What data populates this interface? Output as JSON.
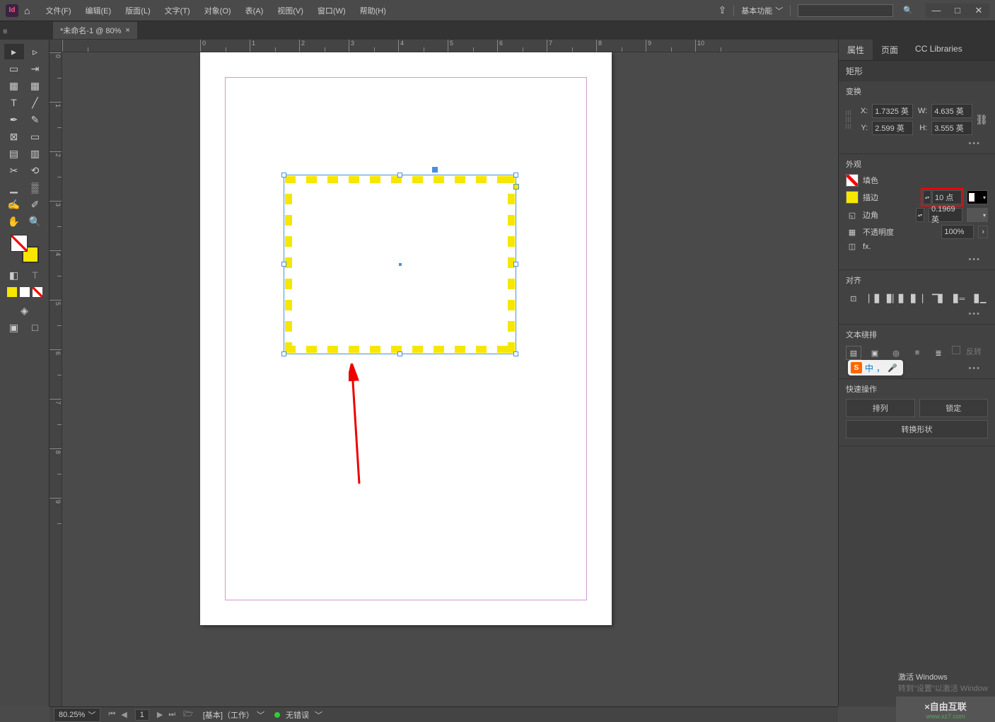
{
  "app_icon": "Id",
  "menu": {
    "file": "文件(F)",
    "edit": "编辑(E)",
    "layout": "版面(L)",
    "text": "文字(T)",
    "object": "对象(O)",
    "table": "表(A)",
    "view": "视图(V)",
    "window": "窗口(W)",
    "help": "帮助(H)"
  },
  "workspace": "基本功能",
  "tab": {
    "title": "*未命名-1 @ 80%"
  },
  "ruler_h": [
    "0",
    "1",
    "2",
    "3",
    "4",
    "5",
    "6",
    "7",
    "8",
    "9",
    "10"
  ],
  "ruler_v": [
    "0",
    "1",
    "2",
    "3",
    "4",
    "5",
    "6",
    "7",
    "8",
    "9"
  ],
  "panel": {
    "tabs": {
      "properties": "属性",
      "pages": "页面",
      "cc": "CC Libraries"
    },
    "object_type": "矩形",
    "transform": {
      "title": "变换",
      "x": "1.7325 英",
      "y": "2.599 英",
      "w": "4.635 英",
      "h": "3.555 英"
    },
    "appearance": {
      "title": "外观",
      "fill": "填色",
      "stroke": "描边",
      "stroke_weight": "10 点",
      "corner": "边角",
      "corner_val": "0.1969 英",
      "opacity": "不透明度",
      "opacity_val": "100%",
      "fx": "fx."
    },
    "align": {
      "title": "对齐"
    },
    "textwrap": {
      "title": "文本绕排",
      "invert": "反转"
    },
    "quick": {
      "title": "快速操作",
      "arrange": "排列",
      "lock": "锁定",
      "convert": "转换形状"
    }
  },
  "status": {
    "zoom": "80.25%",
    "page": "1",
    "layer": "[基本]（工作）",
    "errors": "无错误"
  },
  "activate": {
    "line1": "激活 Windows",
    "line2": "转到\"设置\"以激活 Window"
  },
  "watermark": {
    "name": "×自由互联",
    "url": "www.xz7.com"
  },
  "ime": {
    "s": "S",
    "cn": "中",
    "comma": "，"
  }
}
